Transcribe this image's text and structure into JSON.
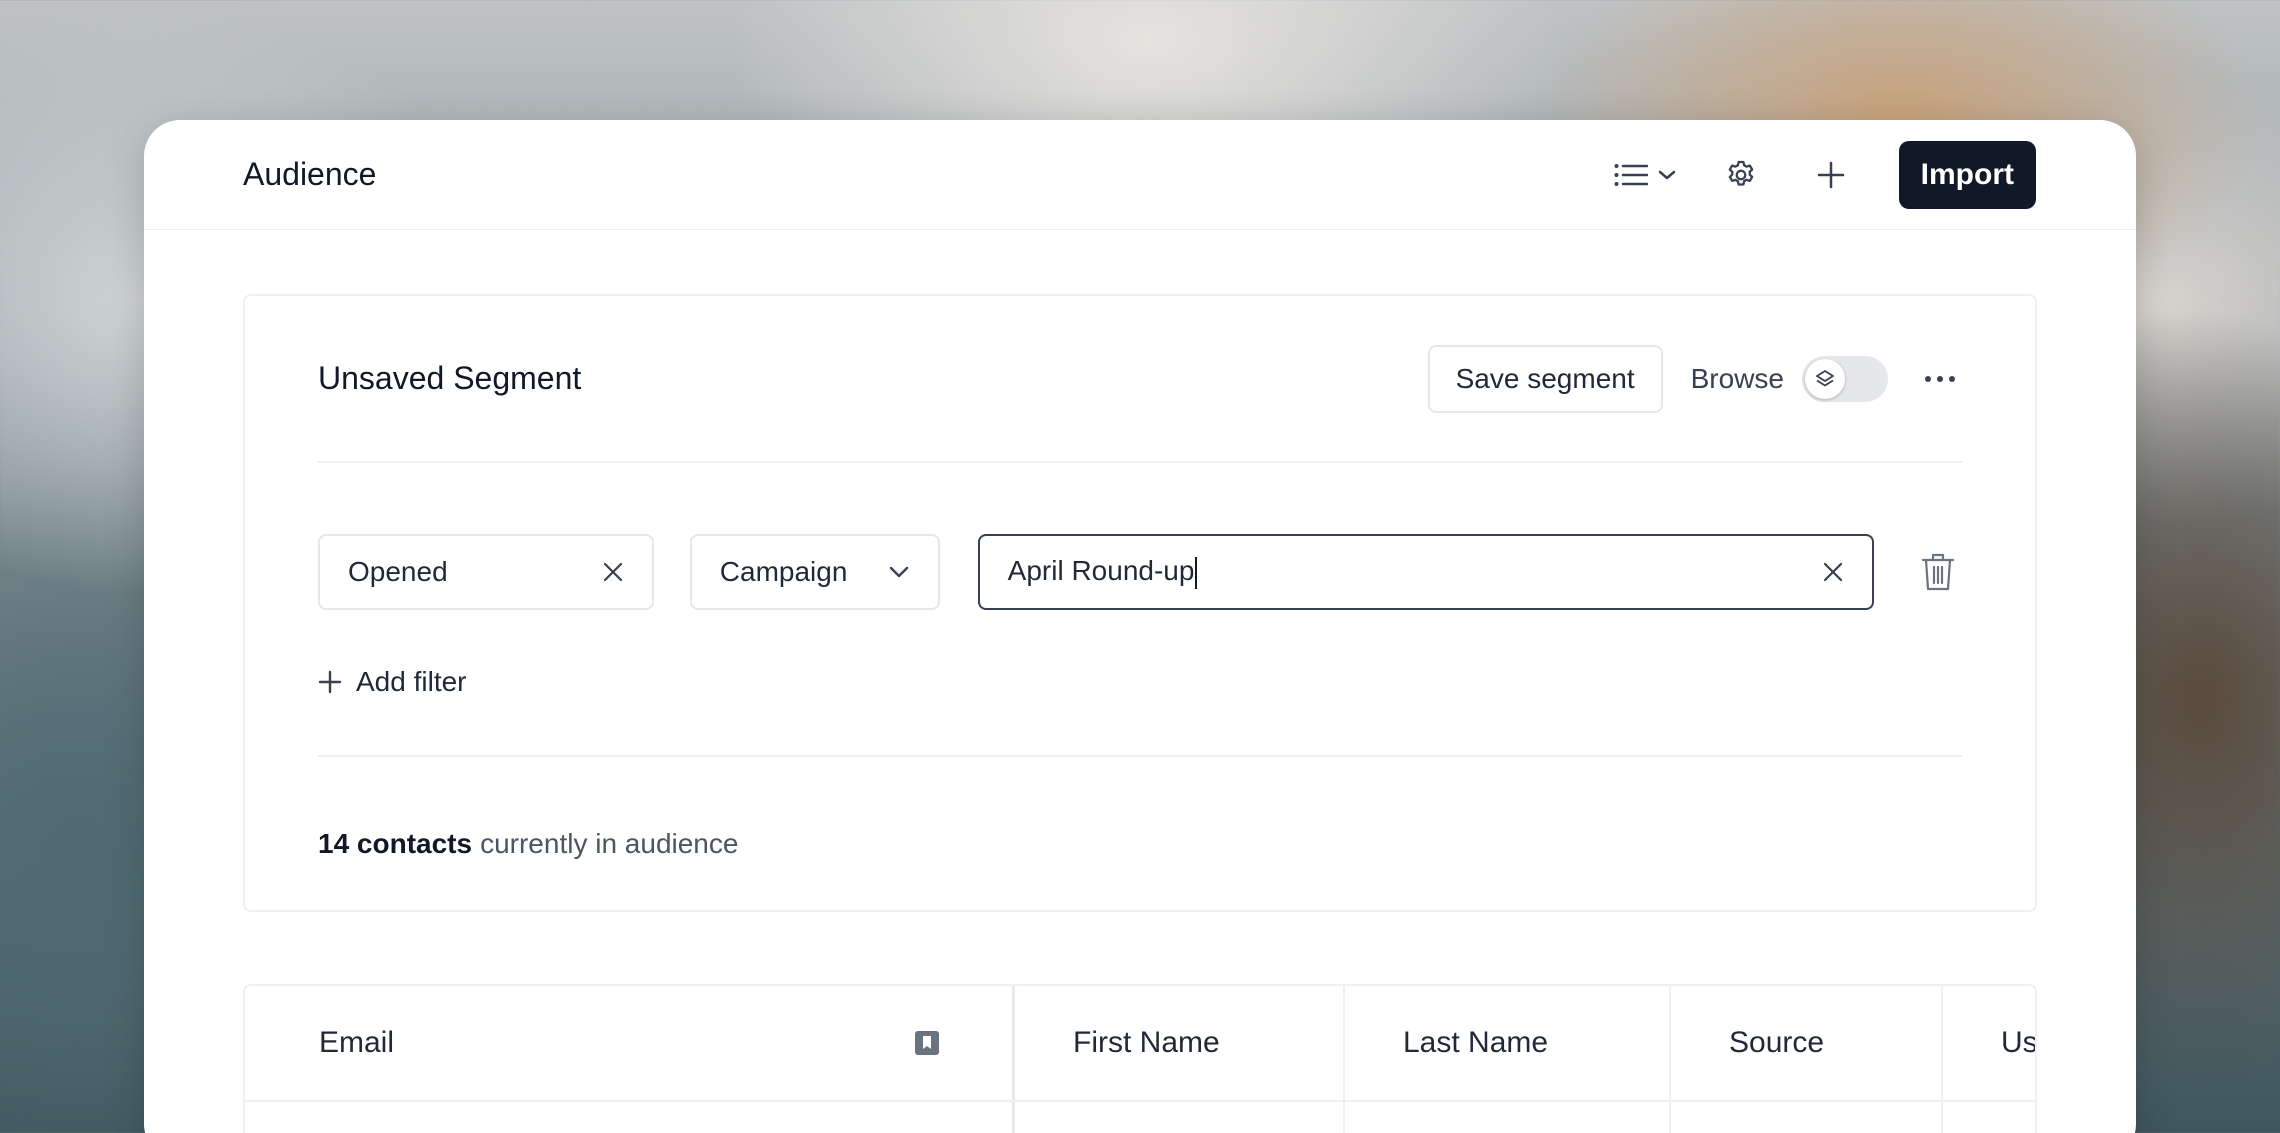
{
  "header": {
    "title": "Audience",
    "import_label": "Import",
    "icons": [
      "list-view-icon",
      "chevron-down-icon",
      "gear-icon",
      "plus-icon"
    ]
  },
  "segment": {
    "title": "Unsaved Segment",
    "save_label": "Save segment",
    "browse_label": "Browse",
    "browse_enabled": false,
    "filter": {
      "event": "Opened",
      "property": "Campaign",
      "value": "April Round-up"
    },
    "add_filter_label": "Add filter",
    "summary": {
      "count_text": "14 contacts",
      "suffix": "currently in audience"
    }
  },
  "table": {
    "columns": [
      "Email",
      "First Name",
      "Last Name",
      "Source",
      "Us"
    ]
  },
  "colors": {
    "primary": "#111827",
    "border": "#e5e7eb",
    "muted_text": "#4b5563"
  }
}
